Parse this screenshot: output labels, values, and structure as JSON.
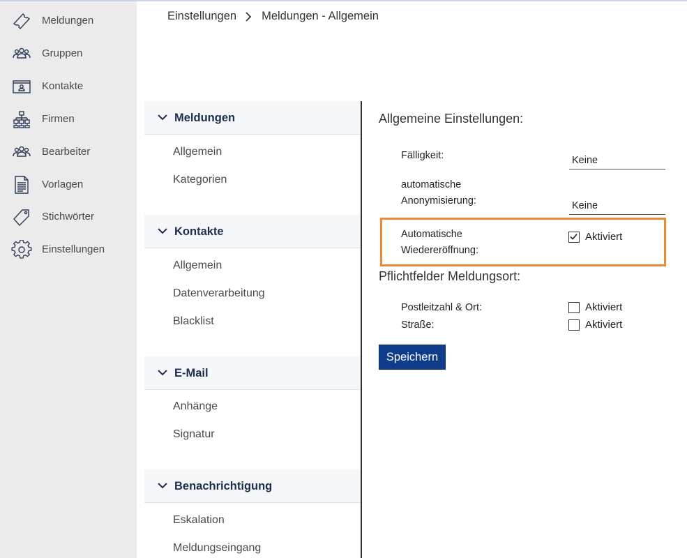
{
  "nav": {
    "items": [
      {
        "label": "Meldungen",
        "icon": "ticket-icon"
      },
      {
        "label": "Gruppen",
        "icon": "group-icon"
      },
      {
        "label": "Kontakte",
        "icon": "contact-card-icon"
      },
      {
        "label": "Firmen",
        "icon": "org-chart-icon"
      },
      {
        "label": "Bearbeiter",
        "icon": "people-icon"
      },
      {
        "label": "Vorlagen",
        "icon": "document-icon"
      },
      {
        "label": "Stichwörter",
        "icon": "tag-icon"
      },
      {
        "label": "Einstellungen",
        "icon": "gear-icon"
      }
    ]
  },
  "breadcrumb": {
    "root": "Einstellungen",
    "current": "Meldungen - Allgemein"
  },
  "submenu": {
    "sections": [
      {
        "title": "Meldungen",
        "links": [
          "Allgemein",
          "Kategorien"
        ]
      },
      {
        "title": "Kontakte",
        "links": [
          "Allgemein",
          "Datenverarbeitung",
          "Blacklist"
        ]
      },
      {
        "title": "E-Mail",
        "links": [
          "Anhänge",
          "Signatur"
        ]
      },
      {
        "title": "Benachrichtigung",
        "links": [
          "Eskalation",
          "Meldungseingang"
        ]
      }
    ]
  },
  "form": {
    "general_heading": "Allgemeine Einstellungen:",
    "due_label": "Fälligkeit:",
    "due_value": "Keine",
    "anon_label_1": "automatische",
    "anon_label_2": "Anonymisierung:",
    "anon_value": "Keine",
    "reopen_label_1": "Automatische",
    "reopen_label_2": "Wiedereröffnung:",
    "reopen_checked": true,
    "reopen_cb_label": "Aktiviert",
    "required_heading": "Pflichtfelder Meldungsort:",
    "zip_label": "Postleitzahl & Ort:",
    "zip_checked": false,
    "zip_cb_label": "Aktiviert",
    "street_label": "Straße:",
    "street_checked": false,
    "street_cb_label": "Aktiviert",
    "save_label": "Speichern"
  },
  "colors": {
    "sidebar_bg": "#ebebeb",
    "highlight": "#ec8a36",
    "primary_button": "#0f3c8a",
    "section_title": "#1d2d4e"
  }
}
